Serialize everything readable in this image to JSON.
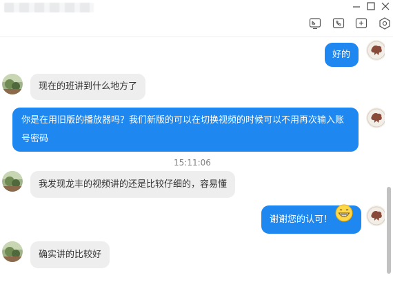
{
  "window": {
    "title_blurred": true,
    "controls": [
      "minimize",
      "maximize",
      "close"
    ]
  },
  "toolbar": {
    "buttons": [
      "screen-share-icon",
      "phone-icon",
      "add-icon",
      "settings-hexagon-icon"
    ]
  },
  "colors": {
    "accent": "#1e87f0",
    "received_bubble": "#eeeeee",
    "timestamp_text": "#808080"
  },
  "messages": [
    {
      "sender": "me",
      "text": "好的"
    },
    {
      "sender": "them",
      "text": "现在的班讲到什么地方了"
    },
    {
      "sender": "me",
      "text": "你是在用旧版的播放器吗？我们新版的可以在切换视频的时候可以不用再次输入账号密码"
    },
    {
      "sender": "them",
      "text": "我发现龙丰的视频讲的还是比较仔细的，容易懂"
    },
    {
      "sender": "me",
      "text": "谢谢您的认可！",
      "emoji": "grinning-face-icon"
    },
    {
      "sender": "them",
      "text": "确实讲的比较好"
    }
  ],
  "timestamp": "15:11:06"
}
